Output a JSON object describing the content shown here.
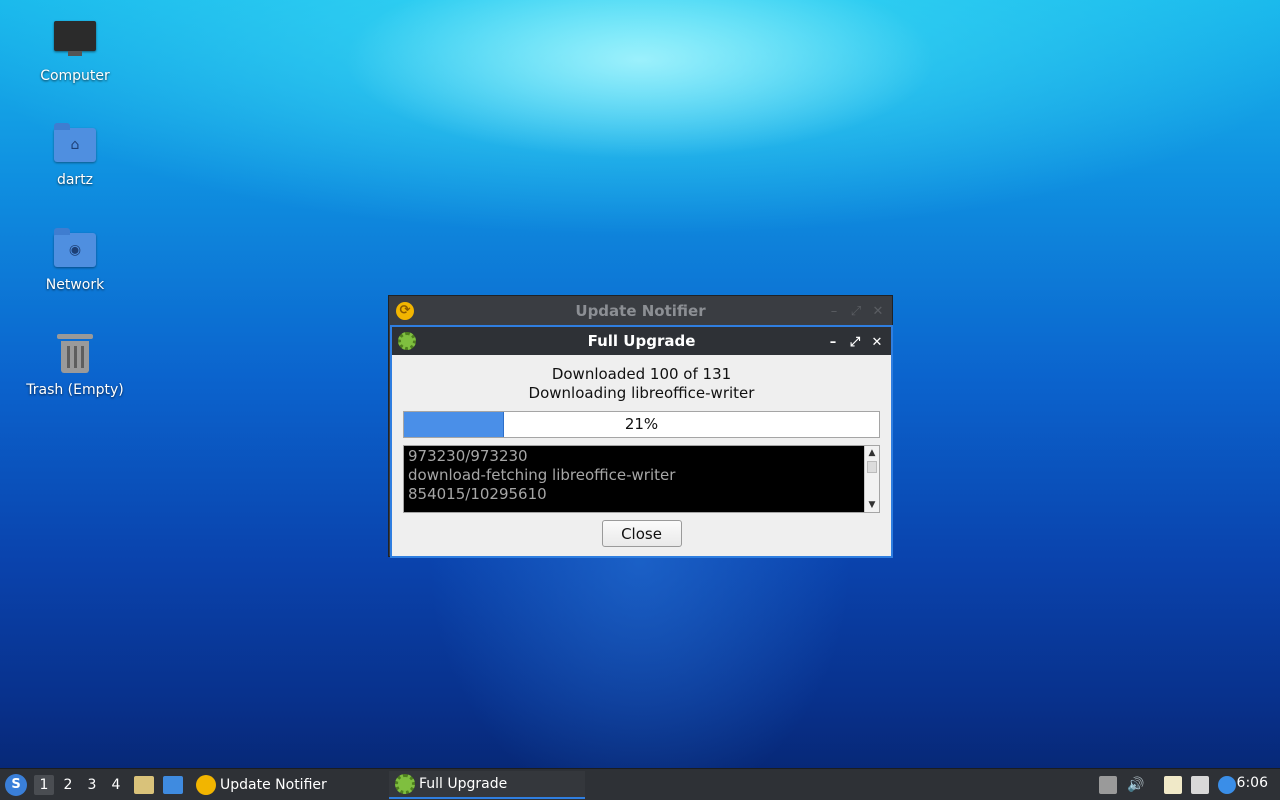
{
  "desktop": {
    "icons": [
      {
        "label": "Computer",
        "icon": "computer-icon"
      },
      {
        "label": "dartz",
        "icon": "home-folder-icon"
      },
      {
        "label": "Network",
        "icon": "network-folder-icon"
      },
      {
        "label": "Trash (Empty)",
        "icon": "trash-icon"
      }
    ]
  },
  "parent_window": {
    "title": "Update Notifier",
    "icon": "update-notifier-icon"
  },
  "dialog": {
    "title": "Full Upgrade",
    "icon": "gear-icon",
    "status_line1": "Downloaded 100 of 131",
    "status_line2": "Downloading libreoffice-writer",
    "progress_label": "21%",
    "progress_fraction": 0.21,
    "terminal_lines": [
      "973230/973230",
      "download-fetching libreoffice-writer",
      "854015/10295610"
    ],
    "close_label": "Close",
    "wm": {
      "minimize": "–",
      "maximize": "⤢",
      "close": "✕"
    }
  },
  "taskbar": {
    "workspaces": [
      "1",
      "2",
      "3",
      "4"
    ],
    "active_workspace": "1",
    "tasks": [
      {
        "label": "Update Notifier",
        "icon": "update-notifier-icon",
        "active": false
      },
      {
        "label": "Full Upgrade",
        "icon": "gear-icon",
        "active": true
      }
    ],
    "clock": "6:06"
  },
  "colors": {
    "accent": "#2f7ee0",
    "progress_fill": "#4a8fe8",
    "titlebar": "#2e3136",
    "notifier_icon": "#f2b500",
    "gear": "#7fbf3f"
  }
}
